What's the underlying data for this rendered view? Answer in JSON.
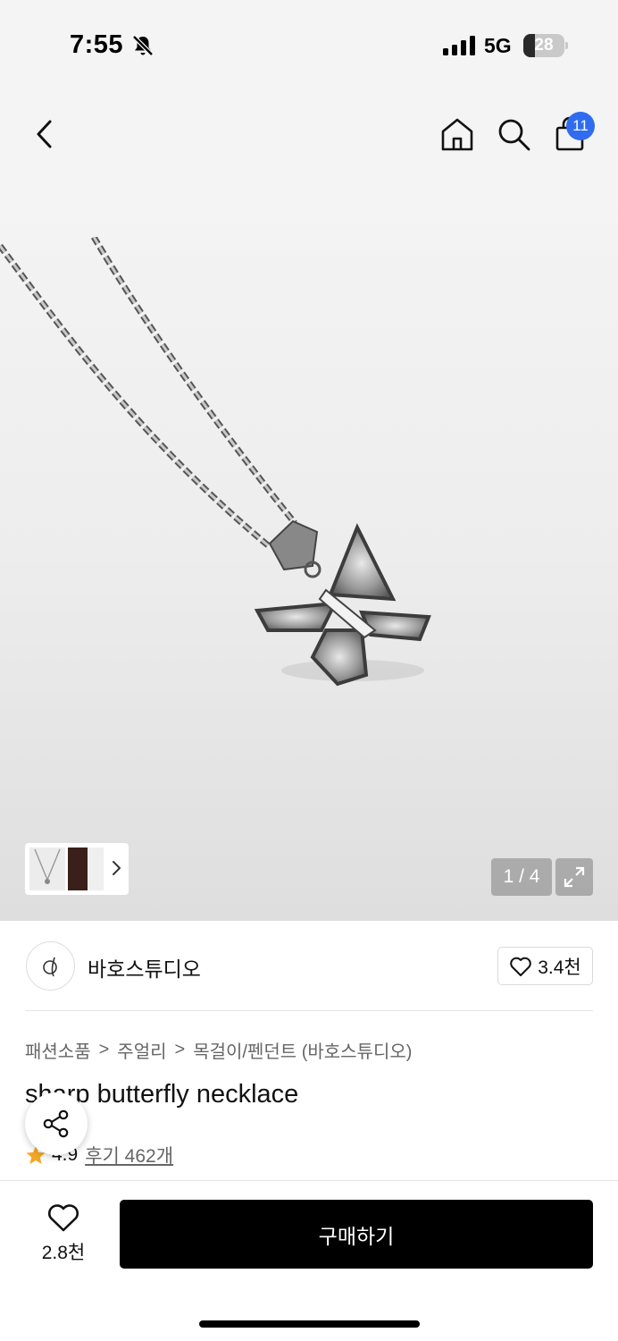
{
  "status_bar": {
    "time": "7:55",
    "network": "5G",
    "battery_level": "28",
    "battery_fraction": 0.28,
    "icons": [
      "bell-muted-icon",
      "signal-icon",
      "battery-icon"
    ]
  },
  "topnav": {
    "icons": [
      "back-icon",
      "home-icon",
      "search-icon",
      "cart-icon"
    ],
    "cart_badge": "11",
    "accent_color": "#2f6cf0"
  },
  "gallery": {
    "pager": "1 / 4",
    "icons": [
      "chevron-right-icon",
      "expand-icon"
    ]
  },
  "brand": {
    "name": "바호스튜디오",
    "like_count": "3.4천"
  },
  "breadcrumb": {
    "items": [
      "패션소품",
      "주얼리",
      "목걸이/펜던트 (바호스튜디오)"
    ],
    "separator": ">"
  },
  "product": {
    "title": "sharp butterfly necklace",
    "rating": "4.9",
    "reviews": "후기 462개",
    "rating_color": "#f5a623"
  },
  "bottom": {
    "wish_count": "2.8천",
    "buy_label": "구매하기"
  }
}
